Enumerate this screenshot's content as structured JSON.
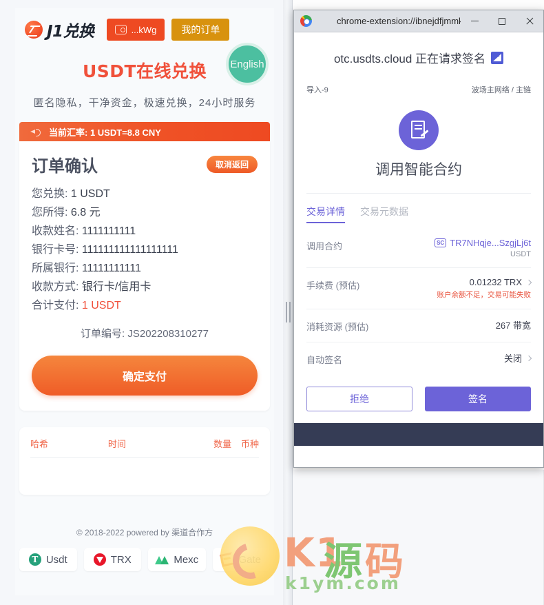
{
  "site": {
    "brand": "J1兑换",
    "wallet_button": "...kWg",
    "orders_button": "我的订单",
    "page_title": "USDT在线兑换",
    "language_badge": "English",
    "tagline": "匿名隐私，干净资金，极速兑换，24小时服务",
    "rate_banner": "当前汇率: 1 USDT=8.8 CNY"
  },
  "order_card": {
    "title": "订单确认",
    "cancel_button": "取消返回",
    "rows": [
      {
        "label": "您兑换:",
        "value": "1 USDT",
        "highlight": false
      },
      {
        "label": "您所得:",
        "value": "6.8 元",
        "highlight": false
      },
      {
        "label": "收款姓名:",
        "value": "1111111111",
        "highlight": false
      },
      {
        "label": "银行卡号:",
        "value": "111111111111111111",
        "highlight": false
      },
      {
        "label": "所属银行:",
        "value": "11111111111",
        "highlight": false
      },
      {
        "label": "收款方式:",
        "value": "银行卡/信用卡",
        "highlight": false
      },
      {
        "label": "合计支付:",
        "value": "1 USDT",
        "highlight": true
      }
    ],
    "order_no_label": "订单编号:",
    "order_no_value": "JS202208310277",
    "pay_button": "确定支付"
  },
  "tx_table": {
    "headers": [
      "哈希",
      "时间",
      "数量",
      "币种"
    ],
    "rows": []
  },
  "footer": {
    "copyright": "© 2018-2022 powered by 渠道合作方",
    "partners": [
      {
        "name": "Usdt",
        "icon": "usdt-icon"
      },
      {
        "name": "TRX",
        "icon": "trx-icon"
      },
      {
        "name": "Mexc",
        "icon": "mexc-icon"
      },
      {
        "name": "Gate",
        "icon": "gate-icon"
      }
    ]
  },
  "watermark": {
    "k1": "K1",
    "yuan": "源",
    "ma": "码",
    "domain": "k1ym.com"
  },
  "extension": {
    "window_title": "chrome-extension://ibnejdfjmmk...",
    "minimize": "—",
    "maximize": "□",
    "close": "✕",
    "sign_request": "otc.usdts.cloud 正在请求签名",
    "account_name": "导入-9",
    "network": "波场主网络 / 主链",
    "contract_title": "调用智能合约",
    "tabs": [
      {
        "label": "交易详情",
        "active": true
      },
      {
        "label": "交易元数据",
        "active": false
      }
    ],
    "details": [
      {
        "label": "调用合约",
        "tag": "SC",
        "value": "TR7NHqje...SzgjLj6t",
        "sub": "USDT",
        "warn": "",
        "chevron": false
      },
      {
        "label": "手续费 (预估)",
        "tag": "",
        "value": "0.01232 TRX",
        "sub": "",
        "warn": "账户余额不足，交易可能失败",
        "chevron": true
      },
      {
        "label": "消耗资源 (预估)",
        "tag": "",
        "value": "267 带宽",
        "sub": "",
        "warn": "",
        "chevron": false
      },
      {
        "label": "自动签名",
        "tag": "",
        "value": "关闭",
        "sub": "",
        "warn": "",
        "chevron": true
      }
    ],
    "reject_button": "拒绝",
    "sign_button": "签名"
  }
}
